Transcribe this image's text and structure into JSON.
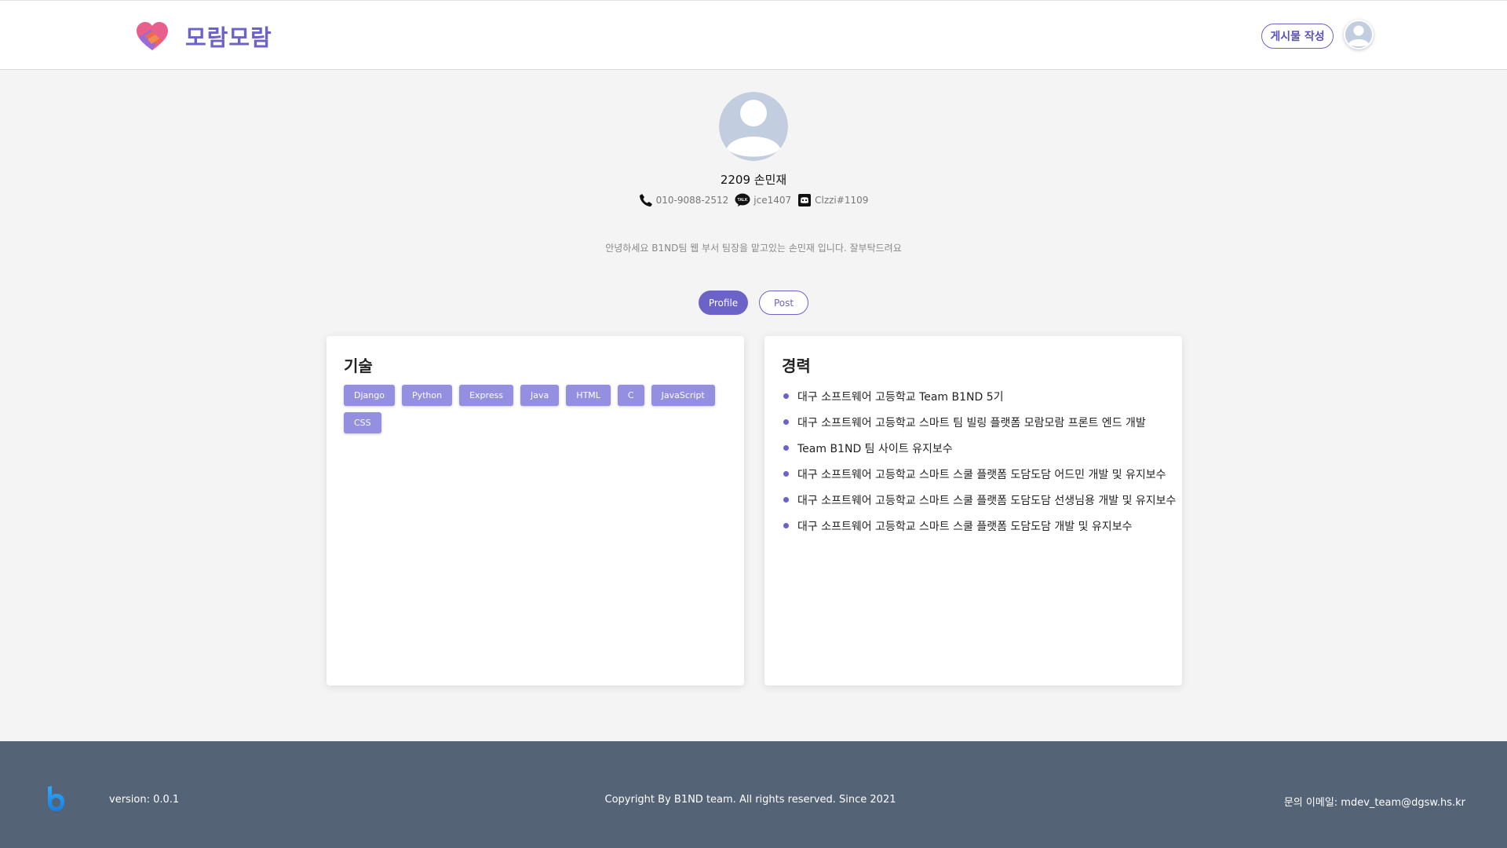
{
  "header": {
    "logo_text": "모람모람",
    "write_button": "게시물 작성"
  },
  "profile": {
    "name": "2209 손민재",
    "phone": "010-9088-2512",
    "kakao": "jce1407",
    "discord": "Clzzi#1109",
    "kakao_badge": "TALK",
    "intro": "안녕하세요 B1ND팀 웹 부서 팀장을 맡고있는 손민재 입니다. 잘부탁드려요"
  },
  "tabs": {
    "profile": "Profile",
    "post": "Post"
  },
  "skills": {
    "title": "기술",
    "items": [
      "Django",
      "Python",
      "Express",
      "Java",
      "HTML",
      "C",
      "JavaScript",
      "CSS"
    ]
  },
  "career": {
    "title": "경력",
    "items": [
      "대구 소프트웨어 고등학교 Team B1ND 5기",
      "대구 소프트웨어 고등학교 스마트 팀 빌링 플랫폼 모람모람 프론트 엔드 개발",
      "Team B1ND 팀 사이트 유지보수",
      "대구 소프트웨어 고등학교 스마트 스쿨 플랫폼 도담도담 어드민 개발 및 유지보수",
      "대구 소프트웨어 고등학교 스마트 스쿨 플랫폼 도담도담 선생님용 개발 및 유지보수",
      "대구 소프트웨어 고등학교 스마트 스쿨 플랫폼 도담도담 개발 및 유지보수"
    ]
  },
  "footer": {
    "version": "version: 0.0.1",
    "copyright": "Copyright By B1ND team. All rights reserved. Since 2021",
    "email": "문의 이메일: mdev_team@dgsw.hs.kr"
  },
  "colors": {
    "accent": "#6c63c8",
    "skill_tag": "#948fe0",
    "footer_bg": "#556377",
    "page_bg": "#f4f4f4"
  },
  "icons": {
    "logo": "heart-handshake-icon",
    "avatar": "user-avatar-icon",
    "phone": "phone-icon",
    "kakao": "kakaotalk-icon",
    "discord": "discord-icon",
    "footer_logo": "b1nd-logo-icon"
  }
}
